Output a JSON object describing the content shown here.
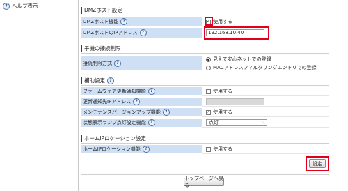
{
  "sidebar": {
    "help_label": "ヘルプ表示"
  },
  "sections": {
    "dmz": {
      "title": "DMZホスト設定",
      "rows": {
        "func_label": "DMZホスト機能",
        "func_value": "使用する",
        "ip_label": "DMZホストのIPアドレス",
        "ip_value": "192.168.10.40"
      }
    },
    "parental": {
      "title": "子機の接続制限",
      "method_label": "接続制限方式",
      "options": [
        "見えて安心ネットでの登録",
        "MACアドレスフィルタリングエントリでの登録"
      ]
    },
    "aux": {
      "title": "補助設定",
      "firmware_label": "ファームウェア更新通知機能",
      "firmware_value": "使用する",
      "notify_ip_label": "更新通知先IPアドレス",
      "maint_label": "メンテナンスバージョンアップ機能",
      "maint_value": "使用する",
      "lamp_label": "状態表示ランプ点灯設定機能",
      "lamp_value": "点灯"
    },
    "homeip": {
      "title": "ホームIPロケーション設定",
      "func_label": "ホームIPロケーション機能",
      "func_value": "使用する"
    }
  },
  "buttons": {
    "set": "設定",
    "back_top": "トップページへ戻る"
  },
  "colors": {
    "label_bg": "#cfe0f4",
    "highlight": "#e0001b"
  }
}
